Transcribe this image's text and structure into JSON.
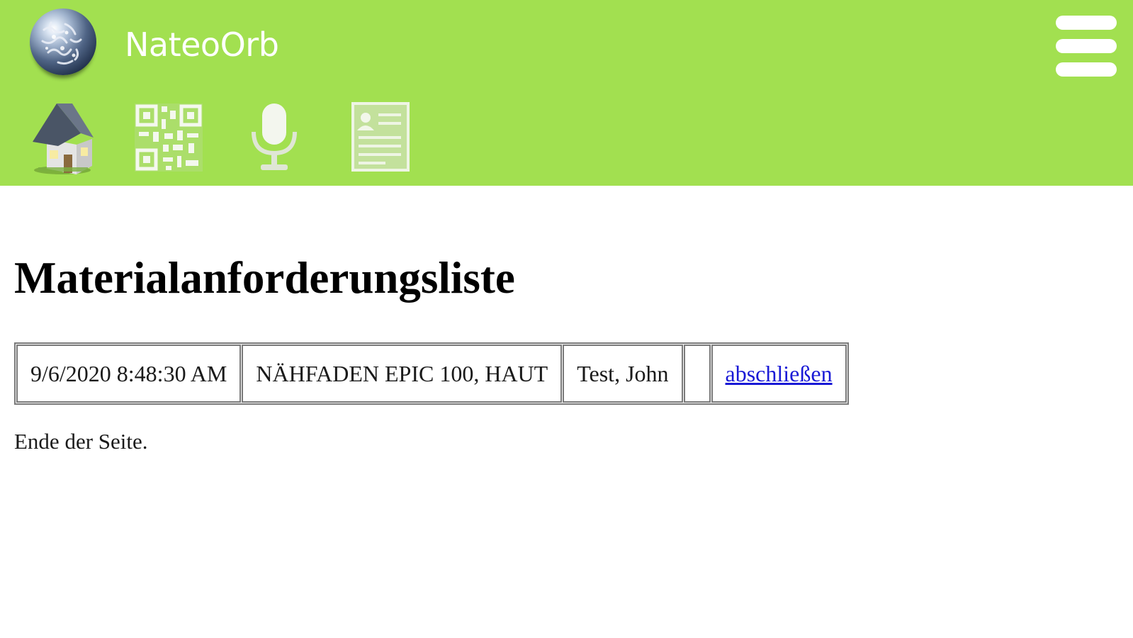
{
  "header": {
    "app_name": "NateoOrb",
    "background_color": "#a2e050",
    "logo_icon": "globe-icon",
    "menu_icon": "hamburger-menu-icon",
    "toolbar": [
      {
        "icon": "home-icon"
      },
      {
        "icon": "qr-code-icon"
      },
      {
        "icon": "microphone-icon"
      },
      {
        "icon": "contact-card-icon"
      }
    ]
  },
  "page": {
    "title": "Materialanforderungsliste",
    "table": {
      "rows": [
        {
          "timestamp": "9/6/2020 8:48:30 AM",
          "material": "NÄHFADEN EPIC 100, HAUT",
          "person": "Test, John",
          "extra": "",
          "action_label": "abschließen"
        }
      ]
    },
    "footer": "Ende der Seite."
  },
  "colors": {
    "link": "#1a1ad6",
    "header_text": "#ffffff"
  }
}
